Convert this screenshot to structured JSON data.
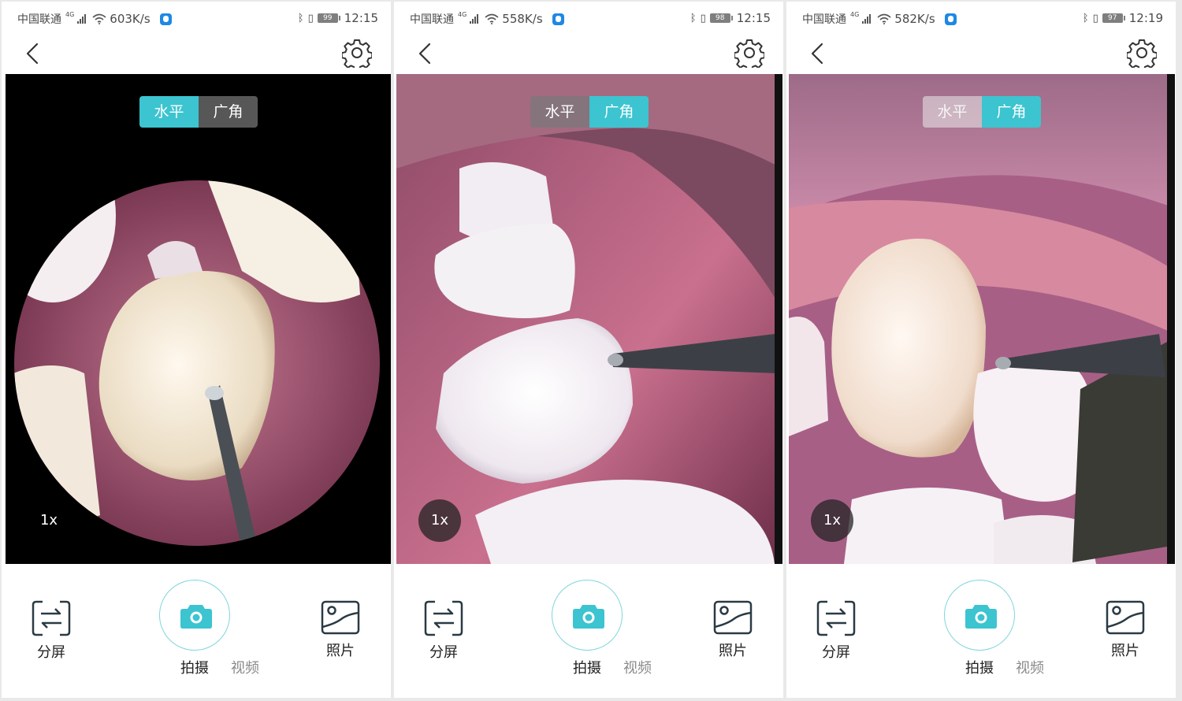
{
  "status": {
    "carrier": "中国联通",
    "network": "4G",
    "clock": "12:15"
  },
  "panels": [
    {
      "speed": "603K/s",
      "battery": "99",
      "clock": "12:15",
      "active_mode": "horizontal",
      "zoom": "1x"
    },
    {
      "speed": "558K/s",
      "battery": "98",
      "clock": "12:15",
      "active_mode": "wide",
      "zoom": "1x"
    },
    {
      "speed": "582K/s",
      "battery": "97",
      "clock": "12:19",
      "active_mode": "wide",
      "zoom": "1x"
    }
  ],
  "toggle": {
    "horizontal": "水平",
    "wide": "广角"
  },
  "bottom": {
    "split": "分屏",
    "capture_photo": "拍摄",
    "capture_video": "视频",
    "photos": "照片"
  },
  "colors": {
    "accent": "#3cc4d0",
    "toggle_off": "#787878",
    "icon": "#2a3a44"
  },
  "icons": {
    "back": "chevron-left-icon",
    "settings": "gear-icon",
    "split": "split-screen-icon",
    "camera": "camera-icon",
    "photos": "gallery-icon"
  }
}
